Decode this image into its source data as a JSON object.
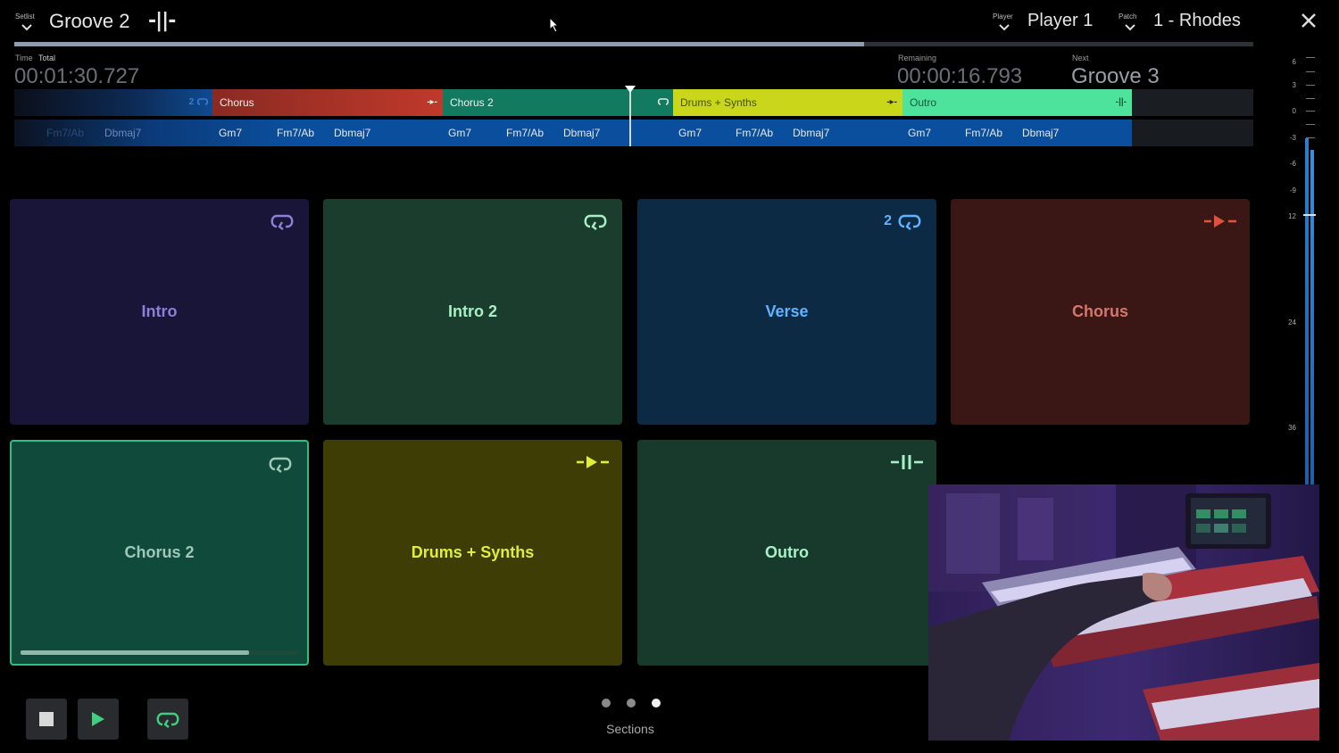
{
  "header": {
    "setlist_label": "Setlist",
    "setlist_title": "Groove 2",
    "setlist_mark": "-||-",
    "player_label": "Player",
    "player_value": "Player 1",
    "patch_label": "Patch",
    "patch_value": "1 - Rhodes",
    "song_progress": 0.686
  },
  "time": {
    "time_label": "Time",
    "total_label": "Total",
    "elapsed": "00:01:30.727",
    "remaining_label": "Remaining",
    "remaining": "00:00:16.793",
    "next_label": "Next",
    "next": "Groove 3"
  },
  "timeline": {
    "segments": [
      {
        "label": "",
        "mark": "2"
      },
      {
        "label": "Chorus",
        "mark": "-▸-"
      },
      {
        "label": "Chorus 2",
        "mark": ""
      },
      {
        "label": "",
        "mark": ""
      },
      {
        "label": "Drums + Synths",
        "mark": "-▸-"
      },
      {
        "label": "Outro",
        "mark": "-||-"
      }
    ],
    "chords": [
      "Fm7/Ab",
      "Dbmaj7",
      "Gm7",
      "Fm7/Ab",
      "Dbmaj7",
      "Gm7",
      "Fm7/Ab",
      "Dbmaj7",
      "Gm7",
      "Fm7/Ab",
      "Dbmaj7",
      "Gm7",
      "Fm7/Ab",
      "Dbmaj7"
    ]
  },
  "meter": {
    "scale": [
      "6",
      "3",
      "0",
      "-3",
      "-6",
      "-9",
      "12",
      "24",
      "36"
    ],
    "level": 0.62
  },
  "pads": [
    {
      "label": "Intro",
      "icon": "loop-icon",
      "count": ""
    },
    {
      "label": "Intro 2",
      "icon": "loop-icon",
      "count": ""
    },
    {
      "label": "Verse",
      "icon": "loop-icon",
      "count": "2"
    },
    {
      "label": "Chorus",
      "icon": "next-arrow-icon",
      "count": ""
    },
    {
      "label": "Chorus 2",
      "icon": "loop-icon",
      "count": "",
      "progress": 0.82,
      "active": true
    },
    {
      "label": "Drums + Synths",
      "icon": "next-arrow-icon",
      "count": ""
    },
    {
      "label": "Outro",
      "icon": "end-icon",
      "count": ""
    }
  ],
  "footer": {
    "page_count": 3,
    "current_page": 3,
    "sections_label": "Sections"
  },
  "colors": {
    "accent_green": "#3fd07f",
    "chord_row": "#0a4f9e",
    "background": "#000000"
  }
}
